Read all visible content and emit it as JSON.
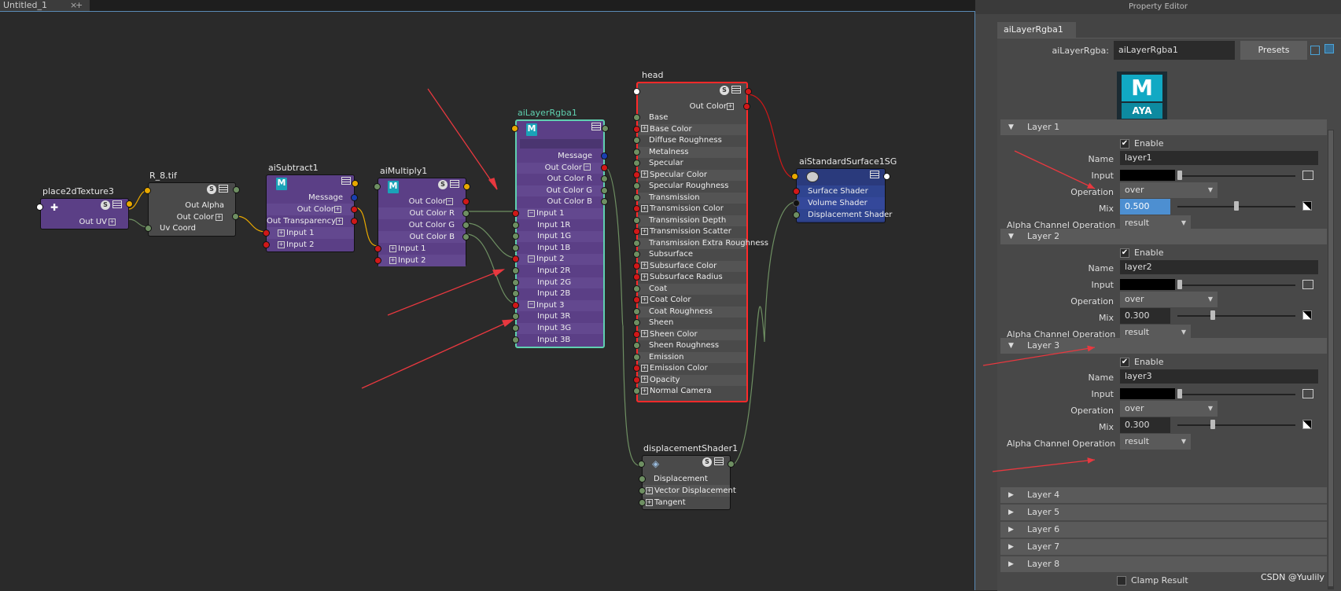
{
  "tabs": {
    "active": "Untitled_1",
    "close": "×",
    "add": "+"
  },
  "nodes": {
    "place2d": {
      "title": "place2dTexture3",
      "rows": [
        "Out UV"
      ]
    },
    "r8": {
      "title": "R_8.tif",
      "rows": [
        "Out Alpha",
        "Out Color",
        "Uv Coord"
      ]
    },
    "subtract": {
      "title": "aiSubtract1",
      "rows": [
        "Message",
        "Out Color",
        "Out Transparency",
        "Input 1",
        "Input 2"
      ]
    },
    "multiply": {
      "title": "aiMultiply1",
      "rows": [
        "Out Color",
        "Out Color R",
        "Out Color G",
        "Out Color B",
        "Input 1",
        "Input 2"
      ]
    },
    "layer": {
      "title": "aiLayerRgba1",
      "rows": [
        "Message",
        "Out Color",
        "Out Color R",
        "Out Color G",
        "Out Color B",
        "Input 1",
        "Input 1R",
        "Input 1G",
        "Input 1B",
        "Input 2",
        "Input 2R",
        "Input 2G",
        "Input 2B",
        "Input 3",
        "Input 3R",
        "Input 3G",
        "Input 3B"
      ]
    },
    "head": {
      "title": "head",
      "out": "Out Color",
      "rows": [
        "Base",
        "Base Color",
        "Diffuse Roughness",
        "Metalness",
        "Specular",
        "Specular Color",
        "Specular Roughness",
        "Transmission",
        "Transmission Color",
        "Transmission Depth",
        "Transmission Scatter",
        "Transmission Extra Roughness",
        "Subsurface",
        "Subsurface Color",
        "Subsurface Radius",
        "Coat",
        "Coat Color",
        "Coat Roughness",
        "Sheen",
        "Sheen Color",
        "Sheen Roughness",
        "Emission",
        "Emission Color",
        "Opacity",
        "Normal Camera"
      ]
    },
    "sg": {
      "title": "aiStandardSurface1SG",
      "rows": [
        "Surface Shader",
        "Volume Shader",
        "Displacement Shader"
      ]
    },
    "disp": {
      "title": "displacementShader1",
      "rows": [
        "Displacement",
        "Vector Displacement",
        "Tangent"
      ]
    }
  },
  "panel": {
    "title": "Property Editor",
    "tab": "aiLayerRgba1",
    "type_label": "aiLayerRgba:",
    "node_name": "aiLayerRgba1",
    "presets": "Presets",
    "logo_m": "M",
    "logo_text": "AYA",
    "labels": {
      "enable": "Enable",
      "name": "Name",
      "input": "Input",
      "operation": "Operation",
      "mix": "Mix",
      "alpha": "Alpha Channel Operation"
    },
    "layers": [
      {
        "title": "Layer 1",
        "enabled": true,
        "name": "layer1",
        "operation": "over",
        "mix": "0.500",
        "mix_value": 0.5,
        "alpha_op": "result"
      },
      {
        "title": "Layer 2",
        "enabled": true,
        "name": "layer2",
        "operation": "over",
        "mix": "0.300",
        "mix_value": 0.3,
        "alpha_op": "result"
      },
      {
        "title": "Layer 3",
        "enabled": true,
        "name": "layer3",
        "operation": "over",
        "mix": "0.300",
        "mix_value": 0.3,
        "alpha_op": "result"
      }
    ],
    "collapsed": [
      "Layer 4",
      "Layer 5",
      "Layer 6",
      "Layer 7",
      "Layer 8"
    ],
    "clamp": "Clamp Result"
  },
  "watermark": "CSDN @Yuulily",
  "colors": {
    "accent": "#5a8ab5",
    "head_border": "#ff2a2a",
    "layer_border": "#5fd0b0",
    "node_purple": "#5b3f86",
    "sg_blue": "#2a3a7c"
  }
}
